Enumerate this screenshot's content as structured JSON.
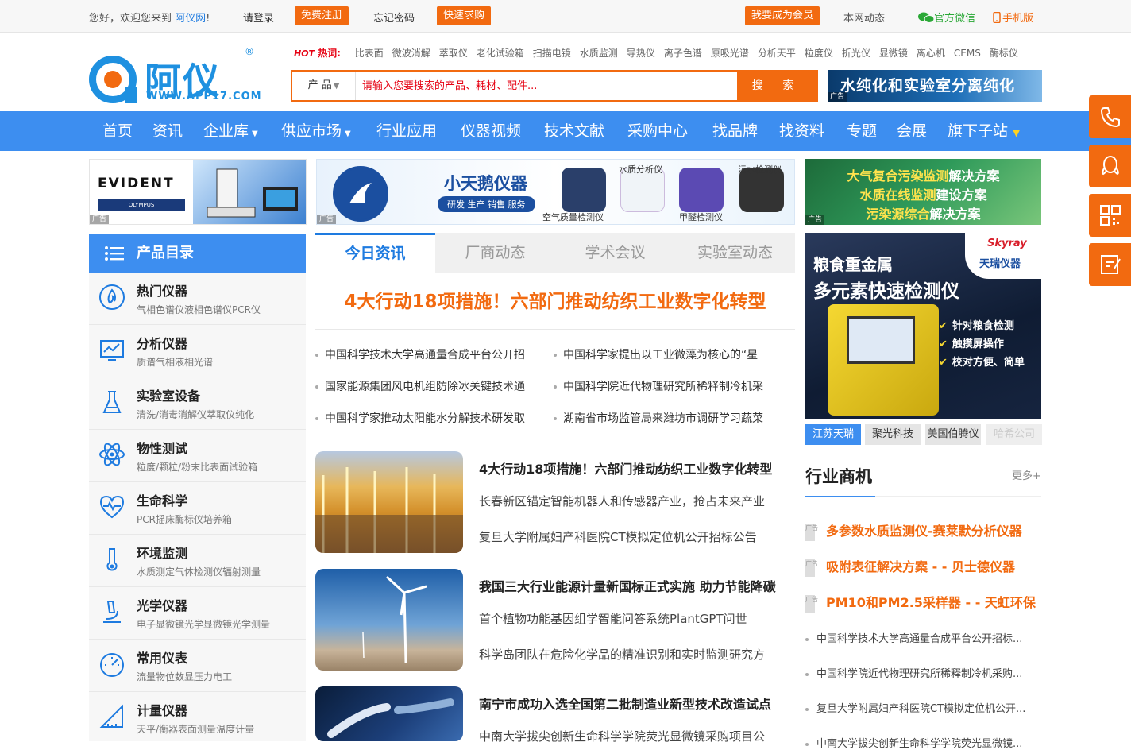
{
  "topbar": {
    "greeting": "您好，欢迎您来到",
    "site_name": "阿仪网",
    "greeting_end": "!",
    "login": "请登录",
    "register": "免费注册",
    "forgot": "忘记密码",
    "quick_buy": "快速求购",
    "become_member": "我要成为会员",
    "site_news": "本网动态",
    "wechat": "官方微信",
    "mobile": "手机版"
  },
  "logo": {
    "name": "阿仪网",
    "url": "WWW.APP17.COM",
    "reg": "®"
  },
  "hot": {
    "tag": "HOT",
    "label": "热词:",
    "keywords": [
      "比表面",
      "微波消解",
      "萃取仪",
      "老化试验箱",
      "扫描电镜",
      "水质监测",
      "导热仪",
      "离子色谱",
      "原吸光谱",
      "分析天平",
      "粒度仪",
      "折光仪",
      "显微镜",
      "离心机",
      "CEMS",
      "酶标仪"
    ]
  },
  "search": {
    "category": "产 品",
    "placeholder": "请输入您要搜索的产品、耗材、配件...",
    "button": "搜 索"
  },
  "ads": {
    "top_right": "水纯化和实验室分离纯化",
    "tag": "广告",
    "evident_brand": "EVIDENT",
    "evident_sub": "OLYMPUS",
    "jdxte_brand": "小天鹅仪器",
    "jdxte_pill": "研发 生产 销售 服务",
    "jdxte_products": [
      "空气质量检测仪",
      "水质分析仪",
      "甲醛检测仪",
      "污水检测仪"
    ],
    "green_lines": [
      [
        "大气复合污染监测",
        "解决方案"
      ],
      [
        "水质在线监测",
        "建设方案"
      ],
      [
        "污染源综合",
        "解决方案"
      ]
    ],
    "skyray_title1": "粮食重金属",
    "skyray_title2": "多元素快速检测仪",
    "skyray_brand": "天瑞仪器",
    "skyray_logo": "Skyray",
    "skyray_checks": [
      "针对粮食检测",
      "触摸屏操作",
      "校对方便、简单"
    ]
  },
  "nav": {
    "items": [
      "首页",
      "资讯",
      "企业库",
      "供应市场",
      "行业应用",
      "仪器视频",
      "技术文献",
      "采购中心",
      "找品牌",
      "找资料",
      "专题",
      "会展",
      "旗下子站"
    ]
  },
  "catalog": {
    "title": "产品目录",
    "items": [
      {
        "title": "热门仪器",
        "subs": [
          "气相色谱仪",
          "液相色谱仪",
          "PCR仪"
        ]
      },
      {
        "title": "分析仪器",
        "subs": [
          "质谱",
          "气相",
          "液相",
          "光谱"
        ]
      },
      {
        "title": "实验室设备",
        "subs": [
          "清洗/消毒",
          "消解仪",
          "萃取仪",
          "纯化"
        ]
      },
      {
        "title": "物性测试",
        "subs": [
          "粒度/颗粒/粉末",
          "比表面",
          "试验箱"
        ]
      },
      {
        "title": "生命科学",
        "subs": [
          "PCR",
          "摇床",
          "酶标仪",
          "培养箱"
        ]
      },
      {
        "title": "环境监测",
        "subs": [
          "水质测定",
          "气体检测仪",
          "辐射测量"
        ]
      },
      {
        "title": "光学仪器",
        "subs": [
          "电子显微镜",
          "光学显微镜",
          "光学测量"
        ]
      },
      {
        "title": "常用仪表",
        "subs": [
          "流量",
          "物位",
          "数显",
          "压力",
          "电工"
        ]
      },
      {
        "title": "计量仪器",
        "subs": [
          "天平/衡器",
          "表面测量",
          "温度计量"
        ]
      }
    ]
  },
  "tabs": [
    "今日资讯",
    "厂商动态",
    "学术会议",
    "实验室动态"
  ],
  "headline": "4大行动18项措施！六部门推动纺织工业数字化转型",
  "news_left": [
    "中国科学技术大学高通量合成平台公开招",
    "国家能源集团风电机组防除冰关键技术通",
    "中国科学家推动太阳能水分解技术研发取"
  ],
  "news_right": [
    "中国科学家提出以工业微藻为核心的“星",
    "中国科学院近代物理研究所稀释制冷机采",
    "湖南省市场监管局来潍坊市调研学习蔬菜"
  ],
  "features": [
    {
      "title": "4大行动18项措施！六部门推动纺织工业数字化转型",
      "subs": [
        "长春新区锚定智能机器人和传感器产业，抢占未来产业",
        "复旦大学附属妇产科医院CT模拟定位机公开招标公告"
      ]
    },
    {
      "title": "我国三大行业能源计量新国标正式实施 助力节能降碳",
      "subs": [
        "首个植物功能基因组学智能问答系统PlantGPT问世",
        "科学岛团队在危险化学品的精准识别和实时监测研究方"
      ]
    },
    {
      "title": "南宁市成功入选全国第二批制造业新型技术改造试点",
      "subs": [
        "中南大学拔尖创新生命科学学院荧光显微镜采购项目公"
      ]
    }
  ],
  "right_tabs": [
    "江苏天瑞",
    "聚光科技",
    "美国伯腾仪",
    "哈希公司"
  ],
  "biz": {
    "title": "行业商机",
    "more": "更多+",
    "ad_tag": "广告",
    "ads": [
      "多参数水质监测仪-赛莱默分析仪器",
      "吸附表征解决方案 - - 贝士德仪器",
      "PM10和PM2.5采样器 - - 天虹环保"
    ],
    "news": [
      "中国科学技术大学高通量合成平台公开招标...",
      "中国科学院近代物理研究所稀释制冷机采购...",
      "复旦大学附属妇产科医院CT模拟定位机公开...",
      "中南大学拔尖创新生命科学学院荧光显微镜..."
    ]
  }
}
